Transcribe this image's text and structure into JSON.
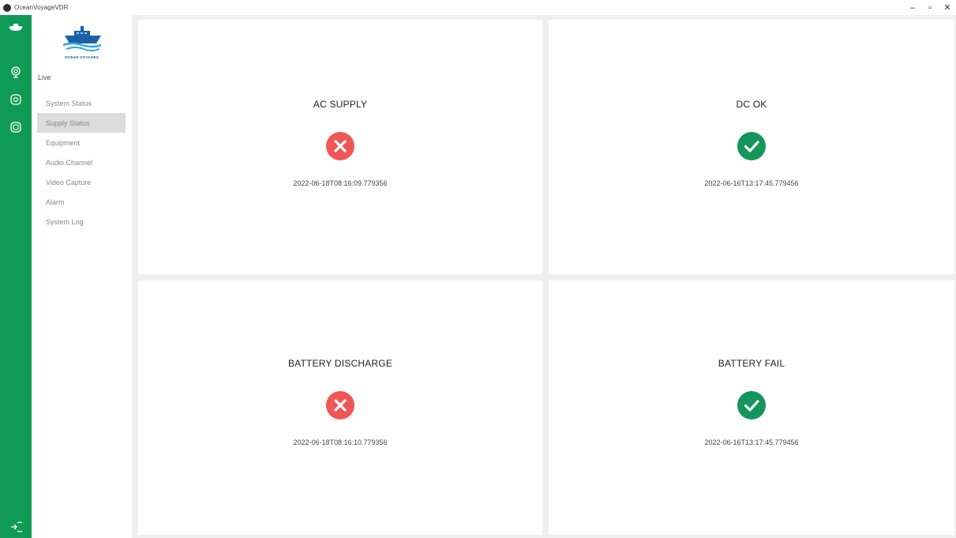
{
  "window": {
    "title": "OceanVoyageVDR",
    "controls": {
      "minimize": "–",
      "maximize": "▫",
      "close": "✕"
    }
  },
  "rail": {
    "icons": [
      "ship-icon",
      "live-radar-icon",
      "camera-settings-icon",
      "storage-icon",
      "logout-icon"
    ]
  },
  "sidebar": {
    "logo_text": "OCEAN VOYAGES",
    "section": "Live",
    "items": [
      {
        "label": "System Status",
        "active": false
      },
      {
        "label": "Supply Status",
        "active": true
      },
      {
        "label": "Equipment",
        "active": false
      },
      {
        "label": "Audio Channel",
        "active": false
      },
      {
        "label": "Video Capture",
        "active": false
      },
      {
        "label": "Alarm",
        "active": false
      },
      {
        "label": "System Log",
        "active": false
      }
    ]
  },
  "cards": [
    {
      "title": "AC SUPPLY",
      "status": "fail",
      "timestamp": "2022-06-18T08:16:09.779356"
    },
    {
      "title": "DC OK",
      "status": "ok",
      "timestamp": "2022-06-16T13:17:45.779456"
    },
    {
      "title": "BATTERY DISCHARGE",
      "status": "fail",
      "timestamp": "2022-06-18T08:16:10.779356"
    },
    {
      "title": "BATTERY FAIL",
      "status": "ok",
      "timestamp": "2022-06-16T13:17:45.779456"
    }
  ],
  "colors": {
    "rail": "#0f9a55",
    "ok": "#15955a",
    "fail": "#f05656",
    "active_menu": "#dcdcdc"
  }
}
